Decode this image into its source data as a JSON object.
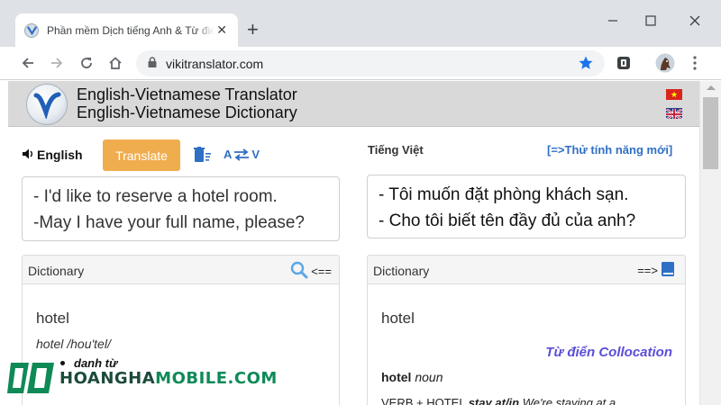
{
  "browser": {
    "tab_title": "Phần mềm Dịch tiếng Anh & Từ điển Anh Việt",
    "url": "vikitranslator.com",
    "icons": [
      "back-icon",
      "forward-icon",
      "reload-icon",
      "home-icon",
      "lock-icon",
      "bookmark-star-icon",
      "extension-icon",
      "profile-avatar",
      "menu-icon",
      "minimize-icon",
      "maximize-icon",
      "close-icon"
    ],
    "accent_color": "#1a73e8"
  },
  "site": {
    "title_line1": "English-Vietnamese Translator",
    "title_line2": "English-Vietnamese Dictionary"
  },
  "translator": {
    "source_lang": "English",
    "translate_label": "Translate",
    "swap_from": "A",
    "swap_to": "V",
    "target_lang": "Tiếng Việt",
    "new_feature_link": "[=>Thử tính năng mới]",
    "source_lines": [
      "- I'd like to reserve a hotel room.",
      "-May I have your full name, please?"
    ],
    "target_lines": [
      "- Tôi muốn đặt phòng khách sạn.",
      "- Cho tôi biết tên đầy đủ của anh?"
    ],
    "button_color": "#f0ad4e"
  },
  "dictionary_left": {
    "header": "Dictionary",
    "arrow": "<==",
    "word": "hotel",
    "phonetic": "hotel /hou'tel/",
    "part_of_speech": "danh từ"
  },
  "dictionary_right": {
    "header": "Dictionary",
    "arrow": "==>",
    "word": "hotel",
    "collocation_link": "Từ điển Collocation",
    "colloc_word": "hotel",
    "colloc_pos": "noun",
    "verb_line_prefix": "VERB + HOTEL",
    "verb_line_bold": "stay at/in",
    "verb_line_example": "We're staying at a"
  },
  "watermark": {
    "brand_part1": "HOANGHA",
    "brand_part2": "MOBILE.COM"
  }
}
